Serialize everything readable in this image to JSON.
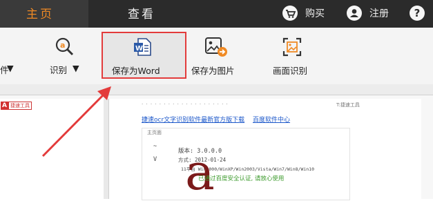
{
  "top_tabs": {
    "home": "主页",
    "view": "查看"
  },
  "top_actions": {
    "buy": "购买",
    "register": "注册",
    "help": "?"
  },
  "toolbar": {
    "partial_left": "件",
    "recognize": "识别",
    "save_word": "保存为Word",
    "save_image": "保存为图片",
    "screen_recognize": "画面识别"
  },
  "preview": {
    "left_tag": "捷速工具",
    "right_top_tag": "T:捷速工具",
    "link_download": "捷速ocr文字识别软件最新官方版下载",
    "link_center": "百度软件中心",
    "card_tab": "主页面",
    "version": "版本: 3.0.0.0",
    "date": "方式: 2012-01-24",
    "os": "11平台 Win2000/WinXP/Win2003/Vista/Win7/Win8/Win10",
    "safety": "已通过百度安全认证, 请放心使用",
    "big_letter": "a",
    "symbol_tilde": "~",
    "symbol_v": "V"
  },
  "colors": {
    "accent_orange": "#f08a24",
    "highlight_red": "#e33b3b",
    "topbar": "#2b2b2b"
  }
}
